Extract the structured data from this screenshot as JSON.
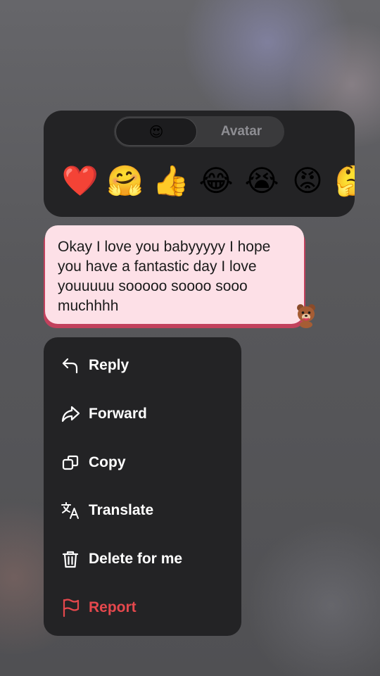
{
  "reaction_panel": {
    "tabs": [
      {
        "label": "😍",
        "selected": true
      },
      {
        "label": "Avatar",
        "selected": false
      }
    ],
    "emojis": [
      {
        "char": "❤️",
        "icon": "red-heart"
      },
      {
        "char": "🤗",
        "icon": "hugging-face"
      },
      {
        "char": "👍",
        "icon": "thumbs-up"
      },
      {
        "char": "😂",
        "icon": "face-with-tears-of-joy"
      },
      {
        "char": "😭",
        "icon": "loudly-crying-face"
      },
      {
        "char": "😡",
        "icon": "pouting-face"
      },
      {
        "char": "🤔",
        "icon": "thinking-face"
      }
    ]
  },
  "message": {
    "text": "Okay I love you babyyyyy I hope you have a fantastic day I love youuuuu sooooo soooo sooo muchhhh",
    "bubble_color": "#fde0e7",
    "accent_color": "#c2415d",
    "reaction_sticker": "bear-sticker"
  },
  "menu": {
    "items": [
      {
        "label": "Reply",
        "icon": "reply-arrow-icon"
      },
      {
        "label": "Forward",
        "icon": "forward-arrow-icon"
      },
      {
        "label": "Copy",
        "icon": "copy-icon"
      },
      {
        "label": "Translate",
        "icon": "translate-icon"
      },
      {
        "label": "Delete for me",
        "icon": "trash-icon"
      },
      {
        "label": "Report",
        "icon": "flag-icon",
        "color": "#e5484d"
      }
    ]
  }
}
